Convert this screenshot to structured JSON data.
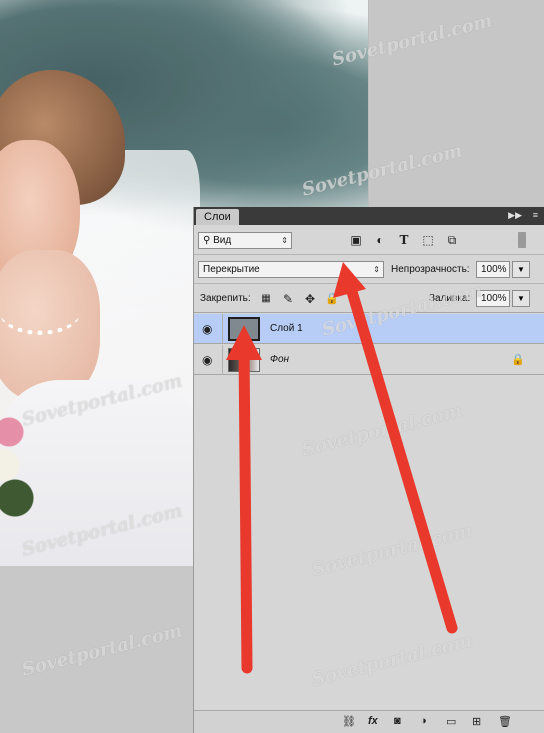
{
  "panel": {
    "tab_label": "Слои",
    "filter_label": "Вид",
    "blend_mode": "Перекрытие",
    "opacity_label": "Непрозрачность:",
    "opacity_value": "100%",
    "lock_label": "Закрепить:",
    "fill_label": "Заливка:",
    "fill_value": "100%"
  },
  "layers": [
    {
      "name": "Слой 1",
      "selected": true
    },
    {
      "name": "Фон",
      "locked": true
    }
  ],
  "watermark": "Sovetportal.com",
  "annotation_color": "#e8392c"
}
